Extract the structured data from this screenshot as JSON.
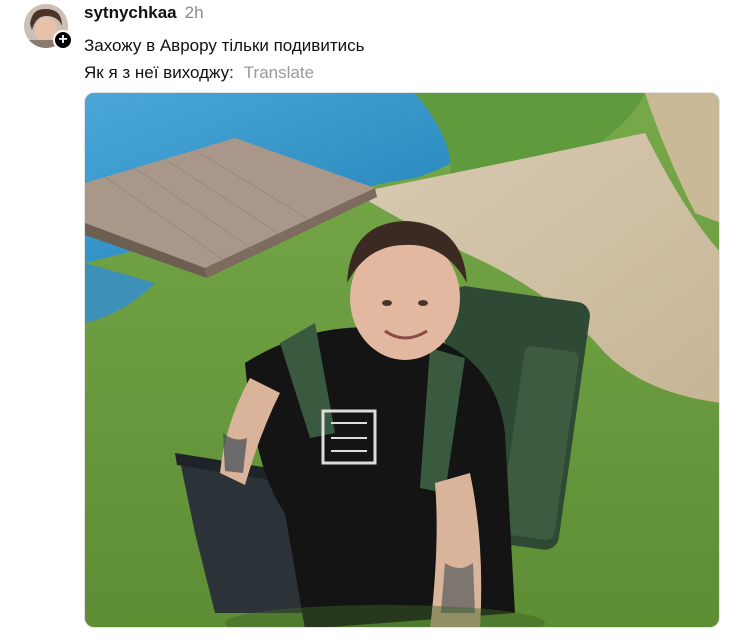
{
  "post": {
    "username": "sytnychkaa",
    "time": "2h",
    "caption_line1": "Захожу в Аврору тільки подивитись",
    "caption_line2": "Як я з неї виходжу:",
    "translate_label": "Translate"
  },
  "icons": {
    "follow": "plus-icon"
  },
  "colors": {
    "username": "#111111",
    "muted": "#8a8a8a",
    "badge": "#000000"
  }
}
